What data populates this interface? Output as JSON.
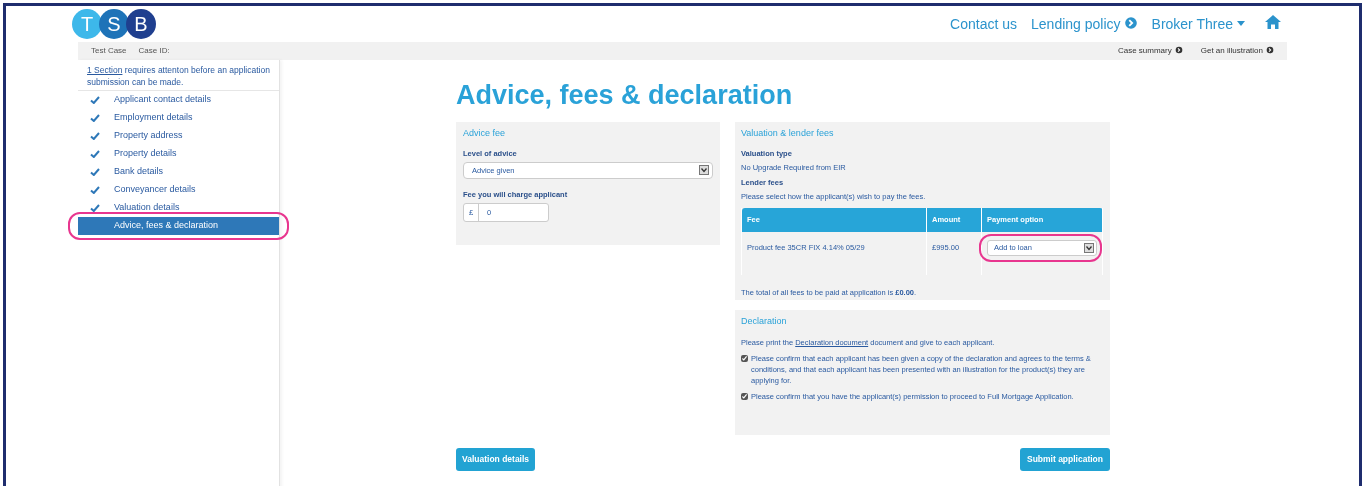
{
  "header": {
    "logo_letters": [
      "T",
      "S",
      "B"
    ],
    "links": [
      {
        "kind": "plain",
        "label": "Contact us"
      },
      {
        "kind": "circle-arrow",
        "label": "Lending policy"
      },
      {
        "kind": "dropdown",
        "label": "Broker Three"
      },
      {
        "kind": "home"
      }
    ]
  },
  "case_bar": {
    "items": [
      "Test Case",
      "Case ID:"
    ],
    "links": [
      "Case summary",
      "Get an illustration"
    ]
  },
  "sidebar": {
    "notice_link": "1 Section",
    "notice": "requires attenton before an application submission can be made.",
    "items": [
      {
        "label": "Applicant contact details",
        "done": true,
        "selected": false,
        "highlighted": false
      },
      {
        "label": "Employment details",
        "done": true,
        "selected": false,
        "highlighted": false
      },
      {
        "label": "Property address",
        "done": true,
        "selected": false,
        "highlighted": false
      },
      {
        "label": "Property details",
        "done": true,
        "selected": false,
        "highlighted": false
      },
      {
        "label": "Bank details",
        "done": true,
        "selected": false,
        "highlighted": false
      },
      {
        "label": "Conveyancer details",
        "done": true,
        "selected": false,
        "highlighted": false
      },
      {
        "label": "Valuation details",
        "done": true,
        "selected": false,
        "highlighted": false
      },
      {
        "label": "Advice, fees & declaration",
        "done": false,
        "selected": true,
        "highlighted": true
      }
    ]
  },
  "page_title": "Advice, fees & declaration",
  "advice_fee": {
    "title": "Advice fee",
    "level_label": "Level of advice",
    "level_value": "Advice given",
    "fee_label": "Fee you will charge applicant",
    "currency": "£",
    "fee_value": "0"
  },
  "valuation": {
    "title": "Valuation & lender fees",
    "type_label": "Valuation type",
    "type_value": "No Upgrade Required from EIR",
    "fees_label": "Lender fees",
    "fees_hint": "Please select how the applicant(s) wish to pay the fees.",
    "table": {
      "columns": [
        "Fee",
        "Amount",
        "Payment option"
      ],
      "rows": [
        {
          "fee": "Product fee 35CR FIX 4.14% 05/29",
          "amount": "£995.00",
          "payment_option": "Add to loan",
          "highlighted": true
        }
      ]
    },
    "total": "The total of all fees to be paid at application is **£0.00**."
  },
  "declaration": {
    "title": "Declaration",
    "intro_before": "Please print the",
    "intro_link": "Declaration document",
    "intro_after": "document and give to each applicant.",
    "confirmations": [
      {
        "text": "Please confirm that each applicant has been given a copy of the declaration and agrees to the terms & conditions, and that each applicant has been presented with an illustration for the product(s) they are applying for.",
        "checked": true
      },
      {
        "text": "Please confirm that you have the applicant(s) permission to proceed to Full Mortgage Application.",
        "checked": true
      }
    ]
  },
  "buttons": {
    "back": "Valuation details",
    "submit": "Submit application"
  }
}
